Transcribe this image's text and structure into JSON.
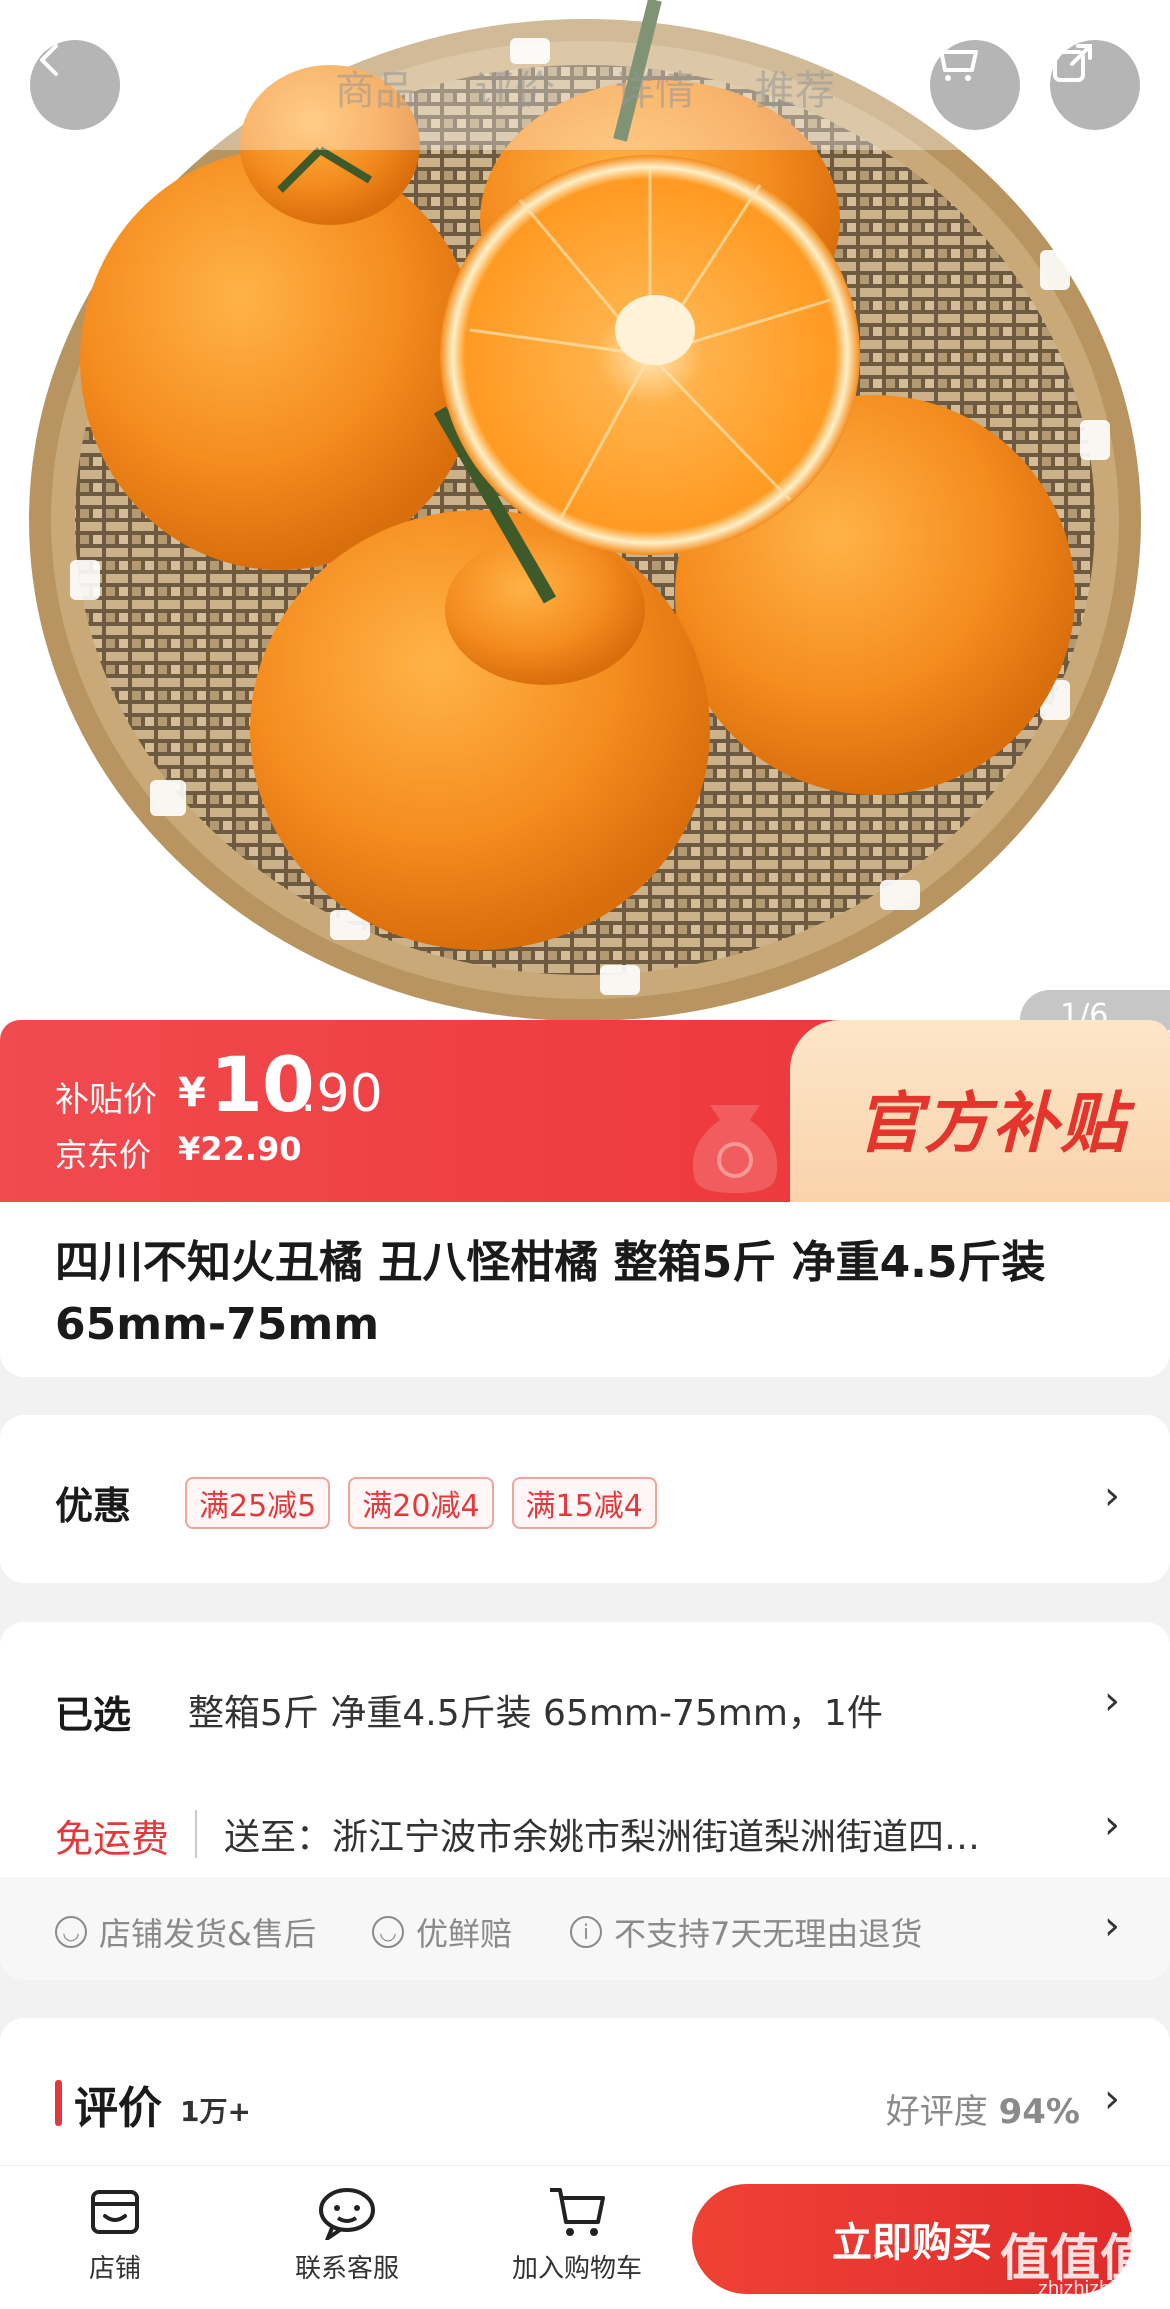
{
  "nav": {
    "tabs": [
      "商品",
      "评价",
      "详情",
      "推荐"
    ],
    "image_indicator": "1/6"
  },
  "price": {
    "subsidy_label": "补贴价",
    "currency": "¥",
    "subsidy_int": "10",
    "subsidy_dec": ".90",
    "jd_label": "京东价",
    "jd_price": "¥22.90",
    "badge": "官方补贴"
  },
  "product": {
    "title": "四川不知火丑橘 丑八怪柑橘 整箱5斤 净重4.5斤装 65mm-75mm"
  },
  "promo": {
    "label": "优惠",
    "coupons": [
      "满25减5",
      "满20减4",
      "满15减4"
    ]
  },
  "selection": {
    "label": "已选",
    "value": "整箱5斤 净重4.5斤装 65mm-75mm，1件",
    "shipping_label": "免运费",
    "address": "送至：浙江宁波市余姚市梨洲街道梨洲街道四…"
  },
  "services": [
    "店铺发货&售后",
    "优鲜赔",
    "不支持7天无理由退货"
  ],
  "reviews": {
    "title": "评价",
    "count": "1万+",
    "rating_label": "好评度",
    "rating_value": "94%"
  },
  "bottom": {
    "shop": "店铺",
    "service": "联系客服",
    "cart": "加入购物车",
    "buy": "立即购买"
  },
  "watermark": {
    "text": "值值值",
    "sub": "zhizhizhi.com"
  },
  "colors": {
    "accent": "#e4393c",
    "subsidy_bg": "#f04b4f",
    "badge_bg": "#fde6c9"
  }
}
